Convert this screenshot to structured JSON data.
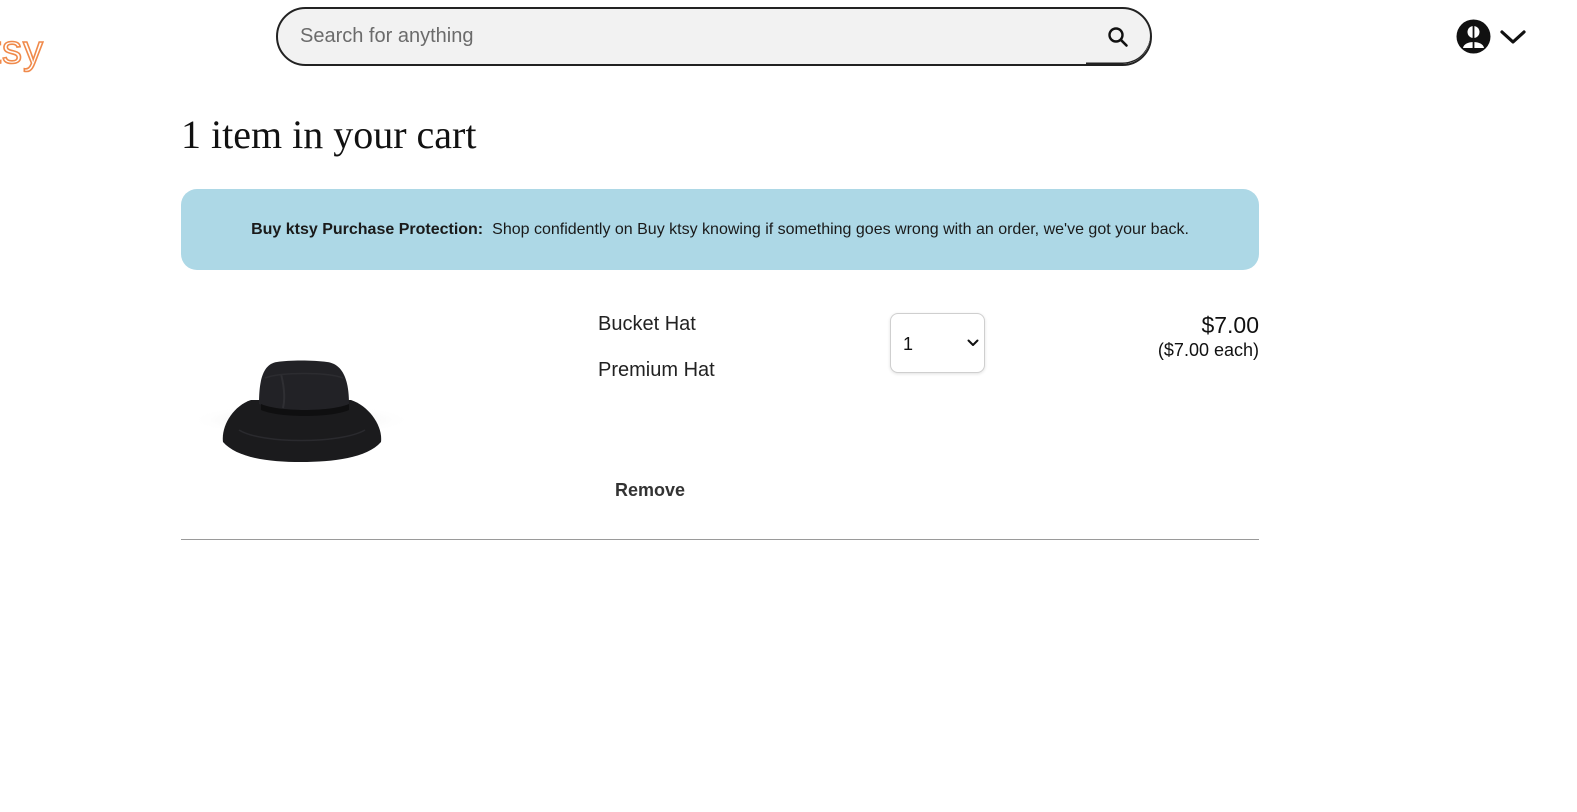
{
  "header": {
    "logo_text": "Buy ktsy",
    "search": {
      "placeholder": "Search for anything",
      "value": ""
    },
    "icons": {
      "search": "search-icon",
      "account": "user-avatar-icon",
      "menu": "chevron-down-icon"
    }
  },
  "cart": {
    "title": "1 item in your cart",
    "banner": {
      "bold": "Buy ktsy Purchase Protection:",
      "text": "Shop confidently on Buy ktsy knowing if something goes wrong with an order, we've got your back.",
      "color": "#add8e6"
    },
    "items": [
      {
        "name": "Bucket Hat",
        "variant": "Premium Hat",
        "quantity": "1",
        "price": "$7.00",
        "price_each": "($7.00 each)",
        "remove_label": "Remove",
        "image": "black-bucket-hat"
      }
    ]
  },
  "colors": {
    "brand": "#f08a4b",
    "banner": "#add8e6"
  }
}
